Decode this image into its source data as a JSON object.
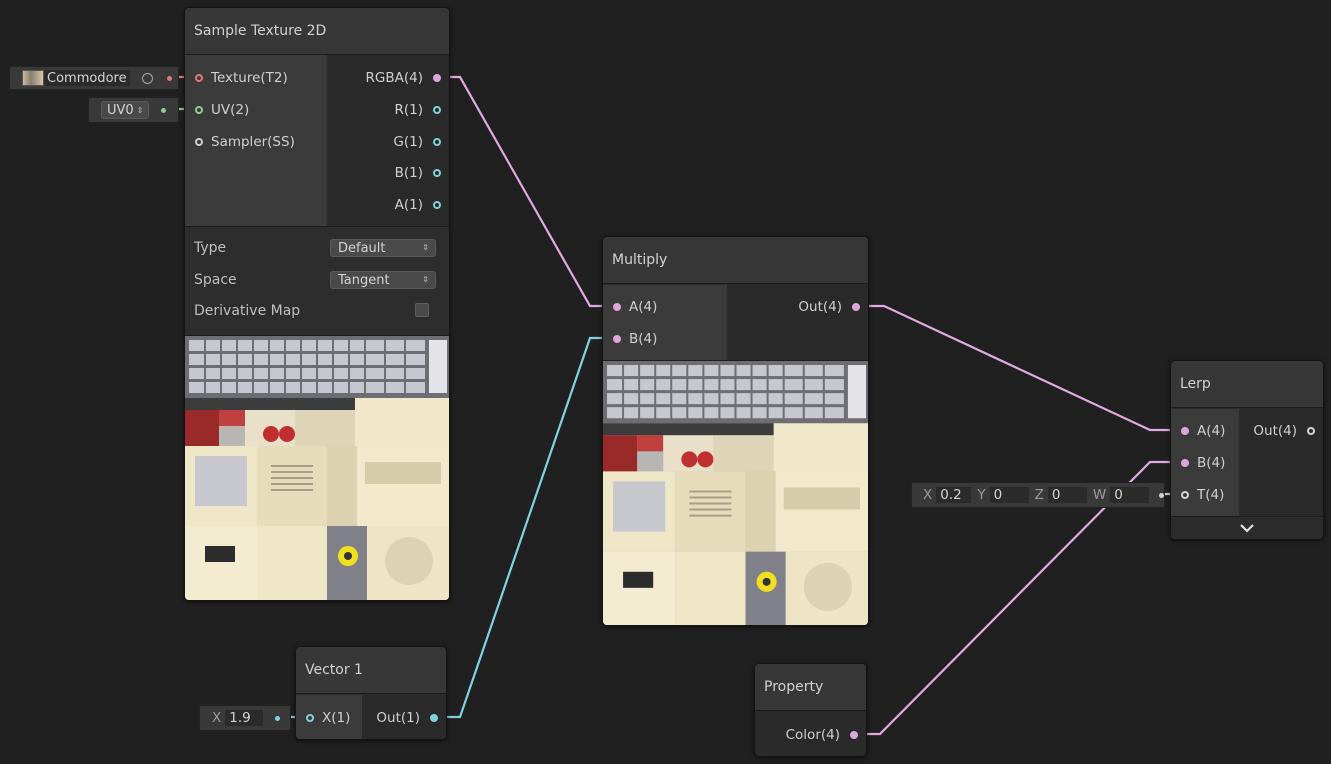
{
  "colors": {
    "background": "#202020",
    "node_body": "#2c2c2c",
    "node_header": "#373737",
    "texture_port": "#e6767a",
    "uv_port": "#8ed08a",
    "vector4_wire": "#e0a6e0",
    "vector1_wire": "#7ed3de"
  },
  "sample_texture": {
    "title": "Sample Texture 2D",
    "inputs": [
      "Texture(T2)",
      "UV(2)",
      "Sampler(SS)"
    ],
    "outputs": [
      "RGBA(4)",
      "R(1)",
      "G(1)",
      "B(1)",
      "A(1)"
    ],
    "type_label": "Type",
    "type_value": "Default",
    "space_label": "Space",
    "space_value": "Tangent",
    "derivative_label": "Derivative Map",
    "derivative_checked": false
  },
  "texture_field": {
    "value": "Commodore",
    "icon": "texture-thumbnail-icon"
  },
  "uv_field": {
    "value": "UV0"
  },
  "multiply": {
    "title": "Multiply",
    "inputs": [
      "A(4)",
      "B(4)"
    ],
    "outputs": [
      "Out(4)"
    ]
  },
  "lerp": {
    "title": "Lerp",
    "inputs": [
      "A(4)",
      "B(4)",
      "T(4)"
    ],
    "outputs": [
      "Out(4)"
    ],
    "expand_icon": "chevron-down-icon"
  },
  "lerp_t_field": {
    "x_label": "X",
    "x_value": "0.2",
    "y_label": "Y",
    "y_value": "0",
    "z_label": "Z",
    "z_value": "0",
    "w_label": "W",
    "w_value": "0"
  },
  "vector1": {
    "title": "Vector 1",
    "inputs": [
      "X(1)"
    ],
    "outputs": [
      "Out(1)"
    ],
    "field_label": "X",
    "field_value": "1.9"
  },
  "property": {
    "title": "Property",
    "outputs": [
      "Color(4)"
    ]
  }
}
